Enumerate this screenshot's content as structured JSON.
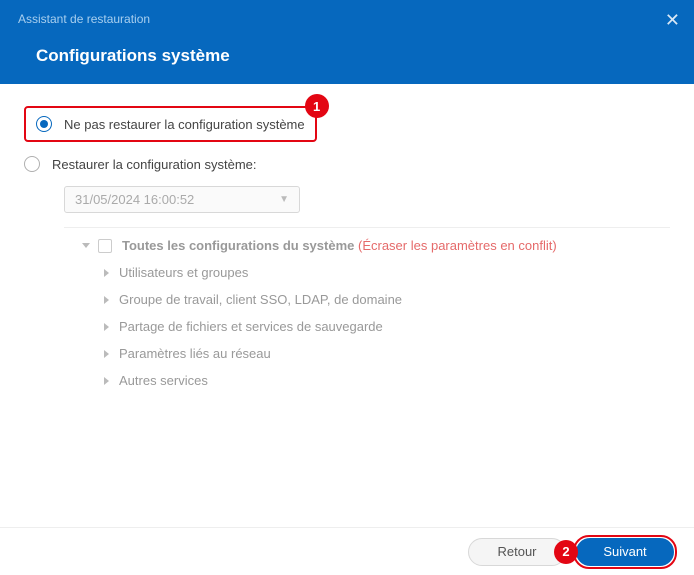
{
  "header": {
    "subtitle": "Assistant de restauration",
    "title": "Configurations système"
  },
  "options": {
    "no_restore": "Ne pas restaurer la configuration système",
    "restore": "Restaurer la configuration système:"
  },
  "snapshot_select": {
    "value": "31/05/2024 16:00:52"
  },
  "tree": {
    "root_label": "Toutes les configurations du système",
    "root_warn": "(Écraser les paramètres en conflit)",
    "items": [
      "Utilisateurs et groupes",
      "Groupe de travail, client SSO, LDAP, de domaine",
      "Partage de fichiers et services de sauvegarde",
      "Paramètres liés au réseau",
      "Autres services"
    ]
  },
  "footer": {
    "back": "Retour",
    "next": "Suivant"
  },
  "callouts": {
    "one": "1",
    "two": "2"
  }
}
